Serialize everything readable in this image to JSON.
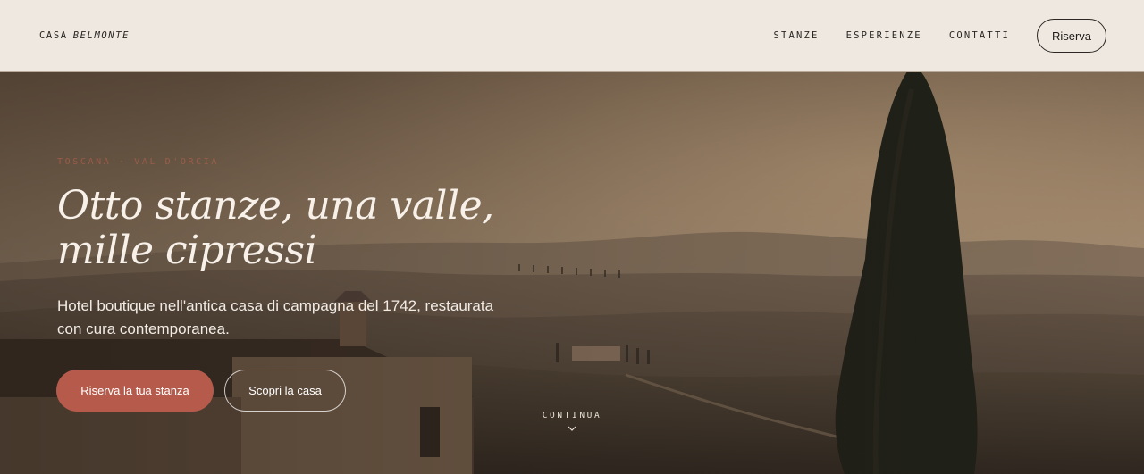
{
  "brand": {
    "name_prefix": "CASA",
    "name_emphasis": "BELMONTE"
  },
  "nav": {
    "items": [
      {
        "label": "STANZE"
      },
      {
        "label": "ESPERIENZE"
      },
      {
        "label": "CONTATTI"
      }
    ],
    "cta_label": "Riserva"
  },
  "hero": {
    "eyebrow": "TOSCANA · VAL D'ORCIA",
    "title_line1": "Otto stanze, una valle,",
    "title_line2": "mille cipressi",
    "subtitle": "Hotel boutique nell'antica casa di campagna del 1742, restaurata con cura contemporanea.",
    "primary_cta": "Riserva la tua stanza",
    "secondary_cta": "Scopri la casa",
    "scroll_label": "CONTINUA",
    "scroll_icon": "chevron-down-icon"
  },
  "colors": {
    "header_bg": "#efe8e0",
    "accent": "#b65b4c",
    "text_light": "#f7f1ea",
    "text_dark": "#2b2724"
  }
}
